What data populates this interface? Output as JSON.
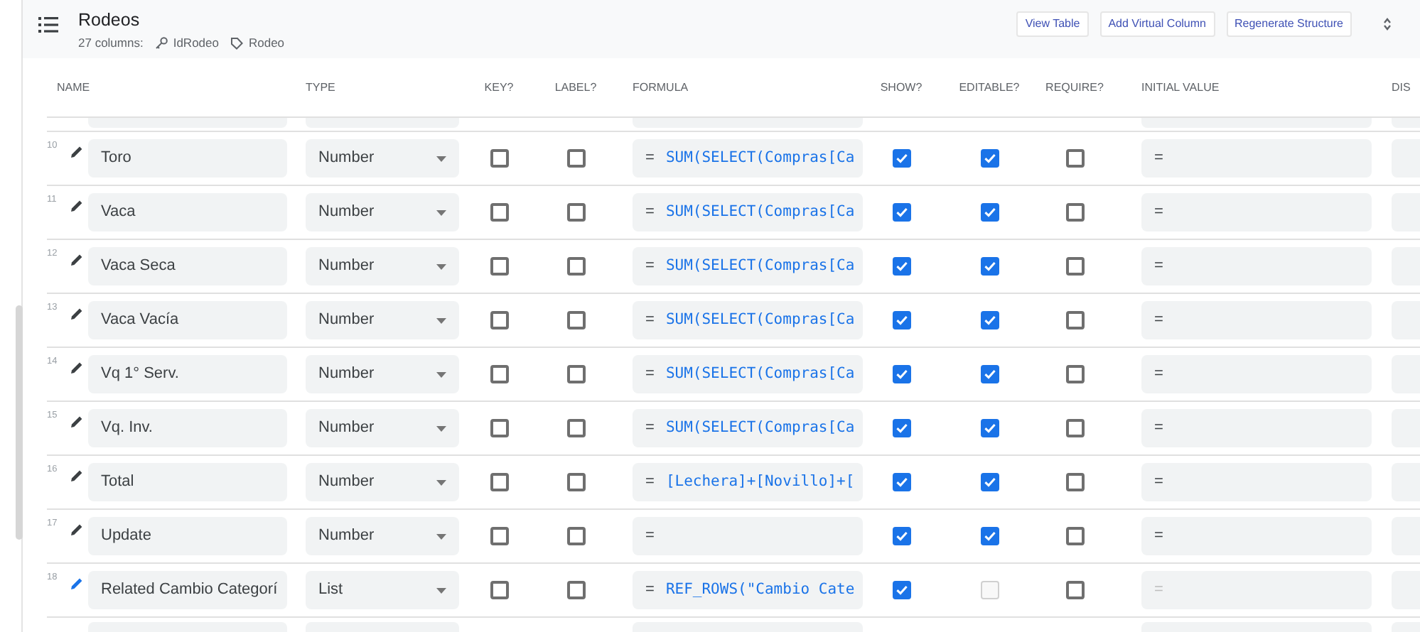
{
  "header": {
    "title": "Rodeos",
    "column_count": "27 columns:",
    "key_column": "IdRodeo",
    "label_column": "Rodeo",
    "buttons": [
      "View Table",
      "Add Virtual Column",
      "Regenerate Structure"
    ]
  },
  "table": {
    "columns": [
      "NAME",
      "TYPE",
      "KEY?",
      "LABEL?",
      "FORMULA",
      "SHOW?",
      "EDITABLE?",
      "REQUIRE?",
      "INITIAL VALUE",
      "DIS"
    ],
    "rows": [
      {
        "number": "10",
        "name": "Toro",
        "type": "Number",
        "key": false,
        "label": false,
        "formula_prefix": "=",
        "formula": "SUM(SELECT(Compras[Ca",
        "show": true,
        "editable": true,
        "editable_disabled": false,
        "require": false,
        "initial_value": "=",
        "initial_value_disabled": false,
        "highlighted": false
      },
      {
        "number": "11",
        "name": "Vaca",
        "type": "Number",
        "key": false,
        "label": false,
        "formula_prefix": "=",
        "formula": "SUM(SELECT(Compras[Ca",
        "show": true,
        "editable": true,
        "editable_disabled": false,
        "require": false,
        "initial_value": "=",
        "initial_value_disabled": false,
        "highlighted": false
      },
      {
        "number": "12",
        "name": "Vaca Seca",
        "type": "Number",
        "key": false,
        "label": false,
        "formula_prefix": "=",
        "formula": "SUM(SELECT(Compras[Ca",
        "show": true,
        "editable": true,
        "editable_disabled": false,
        "require": false,
        "initial_value": "=",
        "initial_value_disabled": false,
        "highlighted": false
      },
      {
        "number": "13",
        "name": "Vaca Vacía",
        "type": "Number",
        "key": false,
        "label": false,
        "formula_prefix": "=",
        "formula": "SUM(SELECT(Compras[Ca",
        "show": true,
        "editable": true,
        "editable_disabled": false,
        "require": false,
        "initial_value": "=",
        "initial_value_disabled": false,
        "highlighted": false
      },
      {
        "number": "14",
        "name": "Vq 1° Serv.",
        "type": "Number",
        "key": false,
        "label": false,
        "formula_prefix": "=",
        "formula": "SUM(SELECT(Compras[Ca",
        "show": true,
        "editable": true,
        "editable_disabled": false,
        "require": false,
        "initial_value": "=",
        "initial_value_disabled": false,
        "highlighted": false
      },
      {
        "number": "15",
        "name": "Vq. Inv.",
        "type": "Number",
        "key": false,
        "label": false,
        "formula_prefix": "=",
        "formula": "SUM(SELECT(Compras[Ca",
        "show": true,
        "editable": true,
        "editable_disabled": false,
        "require": false,
        "initial_value": "=",
        "initial_value_disabled": false,
        "highlighted": false
      },
      {
        "number": "16",
        "name": "Total",
        "type": "Number",
        "key": false,
        "label": false,
        "formula_prefix": "=",
        "formula": "[Lechera]+[Novillo]+[",
        "show": true,
        "editable": true,
        "editable_disabled": false,
        "require": false,
        "initial_value": "=",
        "initial_value_disabled": false,
        "highlighted": false
      },
      {
        "number": "17",
        "name": "Update",
        "type": "Number",
        "key": false,
        "label": false,
        "formula_prefix": "=",
        "show": true,
        "editable": true,
        "editable_disabled": false,
        "require": false,
        "initial_value": "=",
        "initial_value_disabled": false,
        "highlighted": false
      },
      {
        "number": "18",
        "name": "Related Cambio Categorí",
        "type": "List",
        "key": false,
        "label": false,
        "formula_prefix": "=",
        "formula": "REF_ROWS(\"Cambio Cate",
        "show": true,
        "editable": false,
        "editable_disabled": true,
        "require": false,
        "initial_value": "=",
        "initial_value_disabled": true,
        "highlighted": true
      }
    ]
  }
}
